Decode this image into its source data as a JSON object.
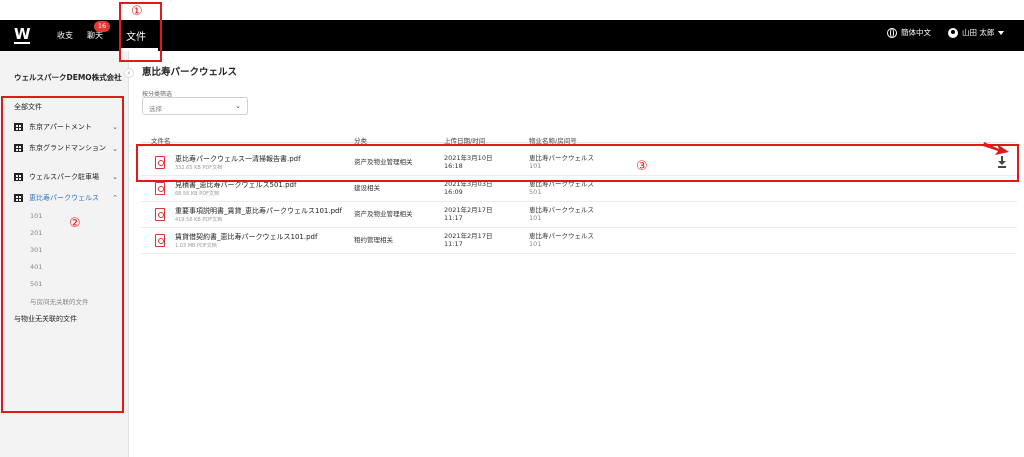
{
  "topbar": {
    "logo": "W",
    "nav": [
      {
        "label": "收支"
      },
      {
        "label": "聊天",
        "badge": "16"
      },
      {
        "label": "文件"
      }
    ],
    "language": "簡体中文",
    "user": "山田 太郎"
  },
  "annotations": [
    "①",
    "②",
    "③"
  ],
  "sidebar": {
    "company": "ウェルスパークDEMO株式会社",
    "all_files": "全部文件",
    "properties": [
      {
        "name": "东京アパートメント"
      },
      {
        "name": "东京グランドマンション"
      },
      {
        "name": "ウェルスパーク駐車場"
      },
      {
        "name": "恵比寿パークウェルス"
      }
    ],
    "rooms": [
      "101",
      "201",
      "301",
      "401",
      "501"
    ],
    "room_unrelated": "与房间无关联的文件",
    "property_unrelated": "与物业无关联的文件"
  },
  "content": {
    "title": "恵比寿パークウェルス",
    "filter_label": "按分类筛选",
    "filter_placeholder": "选择",
    "columns": [
      "文件名",
      "分类",
      "上传日期/时间",
      "物业名称/房间号"
    ],
    "rows": [
      {
        "name": "恵比寿パークウェルス一清掃報告書.pdf",
        "meta": "332.65 KB PDF文档",
        "category": "资产及物业管理相关",
        "date": "2021年3月10日",
        "time": "16:18",
        "property": "恵比寿パークウェルス",
        "room": "101"
      },
      {
        "name": "見積書_恵比寿パークウェルス501.pdf",
        "meta": "68.56 KB PDF文档",
        "category": "建设相关",
        "date": "2021年3月03日",
        "time": "16:09",
        "property": "恵比寿パークウェルス",
        "room": "501"
      },
      {
        "name": "重要事項説明書_賃貸_恵比寿パークウェルス101.pdf",
        "meta": "419.56 KB PDF文档",
        "category": "资产及物业管理相关",
        "date": "2021年2月17日",
        "time": "11:17",
        "property": "恵比寿パークウェルス",
        "room": "101"
      },
      {
        "name": "賃貸借契約書_恵比寿パークウェルス101.pdf",
        "meta": "1.03 MB PDF文档",
        "category": "租约管理相关",
        "date": "2021年2月17日",
        "time": "11:17",
        "property": "恵比寿パークウェルス",
        "room": "101"
      }
    ]
  },
  "colors": {
    "annotation": "#e0191b",
    "active": "#2f73c9",
    "topbar": "#000000"
  }
}
